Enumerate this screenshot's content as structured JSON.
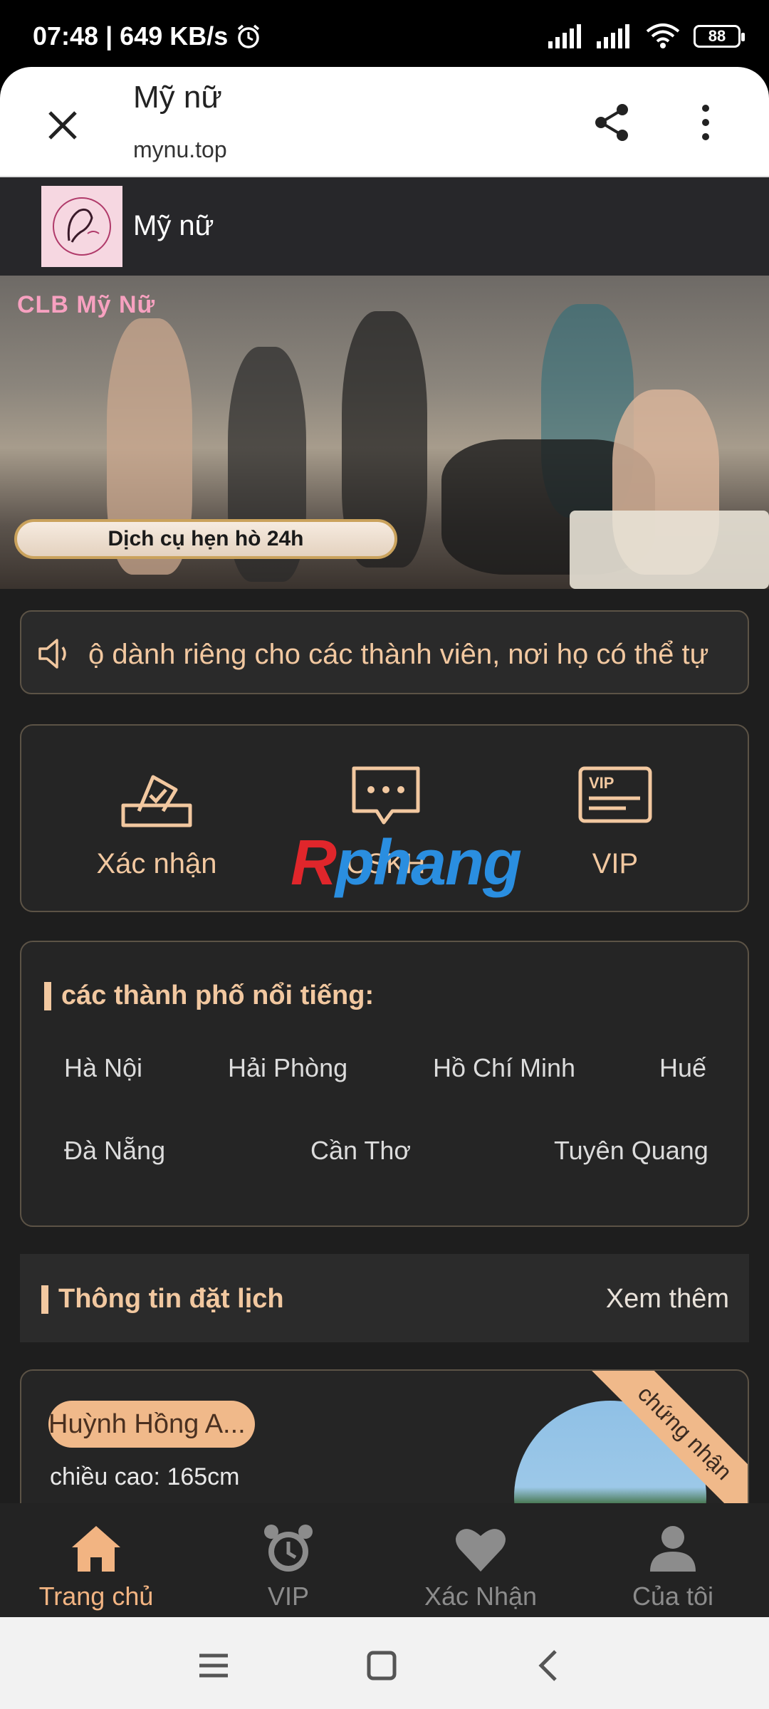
{
  "status_bar": {
    "time": "07:48",
    "speed": "649 KB/s",
    "battery": "88",
    "icons": [
      "alarm-icon",
      "signal-icon",
      "signal-icon",
      "wifi-icon",
      "battery-icon"
    ]
  },
  "browser": {
    "page_title": "Mỹ nữ",
    "url": "mynu.top",
    "icons": [
      "close-icon",
      "share-icon",
      "more-vert-icon"
    ]
  },
  "site": {
    "title": "Mỹ nữ"
  },
  "banner": {
    "tag": "CLB Mỹ Nữ",
    "pill_text": "Dịch cụ hẹn hò 24h"
  },
  "notice": {
    "icon": "speaker-icon",
    "text": "ộ dành riêng cho các thành viên, nơi họ có thể tự"
  },
  "quick_actions": [
    {
      "label": "Xác nhận",
      "icon": "ballot-check-icon"
    },
    {
      "label": "CSKH",
      "icon": "chat-bubble-icon"
    },
    {
      "label": "VIP",
      "icon": "vip-card-icon"
    }
  ],
  "watermark": {
    "part1": "R",
    "part2": "phang"
  },
  "cities": {
    "title": "các thành phố nổi tiếng:",
    "items": [
      "Hà Nội",
      "Hải Phòng",
      "Hồ Chí Minh",
      "Huế",
      "Đà Nẵng",
      "Cần Thơ",
      "Tuyên Quang"
    ]
  },
  "booking": {
    "title": "Thông tin đặt lịch",
    "see_more": "Xem thêm",
    "card": {
      "name": "Huỳnh Hồng A...",
      "height": "chiều cao: 165cm",
      "ribbon": "chứng nhận"
    }
  },
  "bottom_nav": [
    {
      "label": "Trang chủ",
      "icon": "home-icon",
      "active": true
    },
    {
      "label": "VIP",
      "icon": "alarm-clock-icon",
      "active": false
    },
    {
      "label": "Xác Nhận",
      "icon": "heart-icon",
      "active": false
    },
    {
      "label": "Của tôi",
      "icon": "user-icon",
      "active": false
    }
  ],
  "colors": {
    "accent": "#f2c8a0",
    "active_nav": "#f2b482",
    "background": "#1e1e1e",
    "border": "#5c5346"
  }
}
